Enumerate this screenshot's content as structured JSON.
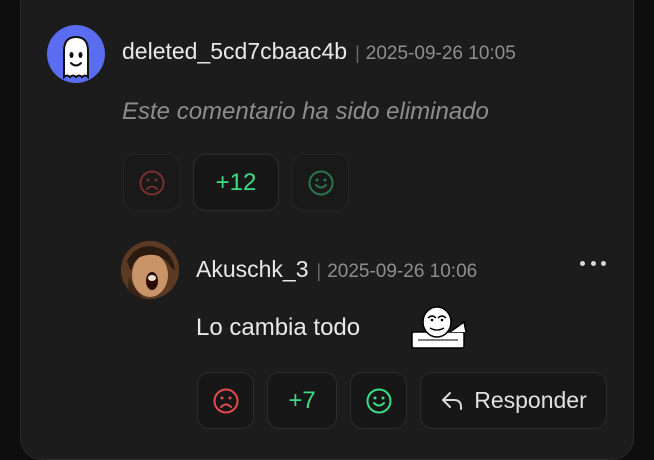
{
  "comment": {
    "username": "deleted_5cd7cbaac4b",
    "separator": "|",
    "timestamp": "2025-09-26 10:05",
    "body": "Este comentario ha sido eliminado",
    "score": "+12",
    "downvote_icon": "sad-face-icon",
    "upvote_icon": "smile-face-icon"
  },
  "reply": {
    "username": "Akuschk_3",
    "separator": "|",
    "timestamp": "2025-09-26 10:06",
    "body": "Lo cambia todo",
    "score": "+7",
    "reply_button_label": "Responder",
    "reply_icon": "reply-arrow-icon",
    "more_icon": "more-dots-icon"
  },
  "colors": {
    "score_green": "#3ddc84",
    "downvote_red": "#e5484d",
    "upvote_green": "#3ddc84",
    "avatar_blue": "#5a6cf0"
  }
}
